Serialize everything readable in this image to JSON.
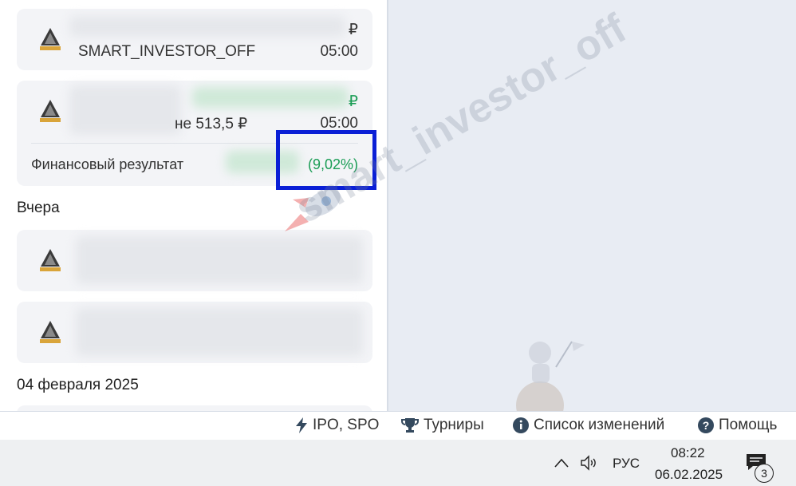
{
  "cards": [
    {
      "ticker": "SMART_INVESTOR_OFF",
      "time": "05:00",
      "currency": "₽"
    },
    {
      "price_text": "не 513,5 ₽",
      "time": "05:00",
      "currency": "₽",
      "result_label": "Финансовый результат",
      "result_value": "(9,02%)"
    }
  ],
  "sections": {
    "yesterday": "Вчера",
    "feb4": "04 февраля 2025"
  },
  "footer": {
    "ipo": "IPO, SPO",
    "tournaments": "Турниры",
    "changelog": "Список изменений",
    "help": "Помощь"
  },
  "taskbar": {
    "lang": "РУС",
    "time": "08:22",
    "date": "06.02.2025",
    "notifications": "3"
  },
  "watermark": "smart_investor_off",
  "colors": {
    "accent_green": "#1a9d55",
    "highlight": "#0a1fd6"
  }
}
